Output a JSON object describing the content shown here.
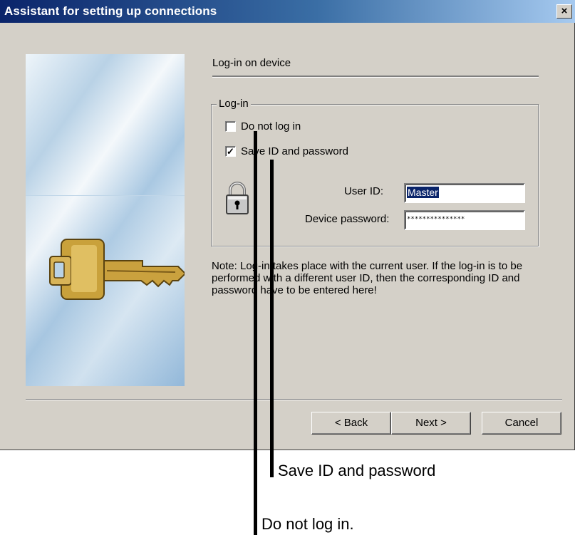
{
  "window": {
    "title": "Assistant for setting up connections",
    "close_glyph": "×"
  },
  "page": {
    "step_title": "Log-in on device"
  },
  "login_group": {
    "legend": "Log-in",
    "do_not_log_in": {
      "label": "Do not log in",
      "checked": false
    },
    "save_id_password": {
      "label": "Save ID and password",
      "checked": true,
      "check_glyph": "✓"
    },
    "user_id": {
      "label": "User ID:",
      "value": "Master"
    },
    "device_password": {
      "label": "Device password:",
      "value": "***************"
    }
  },
  "note": "Note: Log-in takes place with the current user. If the log-in is to be performed with a different user ID, then the corresponding ID and password have to be entered here!",
  "buttons": {
    "back": "< Back",
    "next": "Next >",
    "cancel": "Cancel"
  },
  "callouts": {
    "save": "Save ID and password",
    "do_not_log_in": "Do not log in."
  },
  "icons": {
    "lock": "lock-icon",
    "key": "key-illustration"
  }
}
